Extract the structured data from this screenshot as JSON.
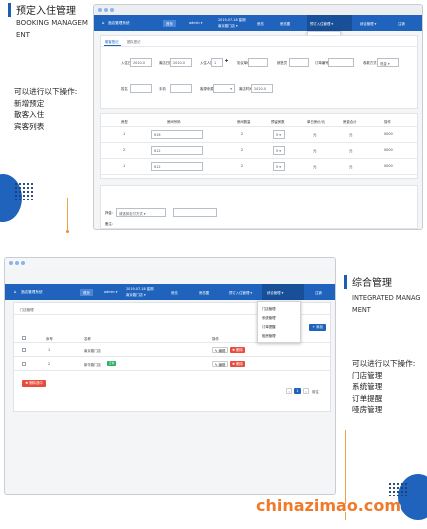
{
  "section1": {
    "title": "预定入住管理",
    "subtitle_en_lines": [
      "BOOKING MANAGEM",
      "ENT"
    ],
    "desc_lines": [
      "可以进行以下操作:",
      "新增预定",
      "散客入住",
      "宾客列表"
    ]
  },
  "section2": {
    "title": "综合管理",
    "subtitle_en_lines": [
      "INTEGRATED MANAG",
      "MENT"
    ],
    "desc_lines": [
      "可以进行以下操作:",
      "门店管理",
      "系统管理",
      "订单提醒",
      "哑房管理"
    ]
  },
  "colors": {
    "nav": "#1f63bd",
    "accent_orange": "#f08a2c",
    "title_bar": "#1a5fb4",
    "danger": "#e74c3c",
    "success": "#27ae60"
  },
  "win1": {
    "nav": {
      "logo_icon": "hotel-logo-icon",
      "logo_text": "酒店管理系统",
      "store_badge": "首页",
      "user": "admin ▾",
      "datetime": "2019-07-18 星期",
      "store": "南京路门店 ▾",
      "room_state": "房态",
      "room_chart": "房态图",
      "checkin": "预订入住管理 ▾",
      "general": "综合管理 ▾",
      "logout": "注销"
    },
    "dropdown": [
      "新增预订",
      "散客入住",
      "宾客列表"
    ],
    "tabs": [
      "散客登记",
      "团队登记"
    ],
    "form": {
      "checkin_label": "入住日期",
      "checkin_value": "2020-0",
      "checkout_label": "离店日期",
      "checkout_value": "2020-0",
      "people_label": "入住人数",
      "people_value": "1",
      "company_label": "协议单位",
      "agent_label": "销售员",
      "orderno_label": "订单编号",
      "pay_label": "收款方式",
      "pay_value": "现金 ▾",
      "name_label": "姓名",
      "phone_label": "手机",
      "source_label": "客源来源",
      "source_value": "▾",
      "remark_label": "离店时间",
      "remark_value": "2020-0"
    },
    "table": {
      "headers": [
        "房型",
        "房间号码",
        "房间数量",
        "预留房数",
        "单日房价/元",
        "房费合计",
        "操作"
      ],
      "rows": [
        {
          "type": "1",
          "room": "¥16",
          "count": "2",
          "reserve": "0 ▾",
          "price": "元",
          "total": "元",
          "op": "0000"
        },
        {
          "type": "2",
          "room": "¥12",
          "count": "2",
          "reserve": "0 ▾",
          "price": "元",
          "total": "元",
          "op": "0000"
        },
        {
          "type": "1",
          "room": "¥12",
          "count": "2",
          "reserve": "0 ▾",
          "price": "元",
          "total": "元",
          "op": "0000"
        }
      ]
    },
    "footer": {
      "pay_label": "押金:",
      "pay_value": "请选择支付方式 ▾",
      "remark_label": "备注:"
    }
  },
  "win2": {
    "nav": {
      "logo_text": "酒店管理系统",
      "store_badge": "首页",
      "user": "admin ▾",
      "datetime": "2019-07-18 星期",
      "store": "南京路门店 ▾",
      "room_state": "房态",
      "room_chart": "房态图",
      "checkin": "预订入住管理 ▾",
      "general": "综合管理 ▾",
      "logout": "注销"
    },
    "dropdown": [
      "门店管理",
      "系统管理",
      "订单提醒",
      "哑房管理"
    ],
    "breadcrumb": "门店管理",
    "add_button": "+ 添加",
    "table": {
      "headers": [
        "序号",
        "名称",
        "操作"
      ],
      "rows": [
        {
          "no": "1",
          "name": "南京路门店",
          "status": "",
          "edit": "✎ 编辑",
          "del": "✖ 删除"
        },
        {
          "no": "2",
          "name": "新华路门店",
          "status": "正常",
          "edit": "✎ 编辑",
          "del": "✖ 删除"
        }
      ]
    },
    "batch_delete": "✖ 删除选中",
    "pagination": {
      "prev": "‹",
      "current": "1",
      "next": "›",
      "goto": "前往"
    }
  },
  "watermark": "chinazimao.com"
}
